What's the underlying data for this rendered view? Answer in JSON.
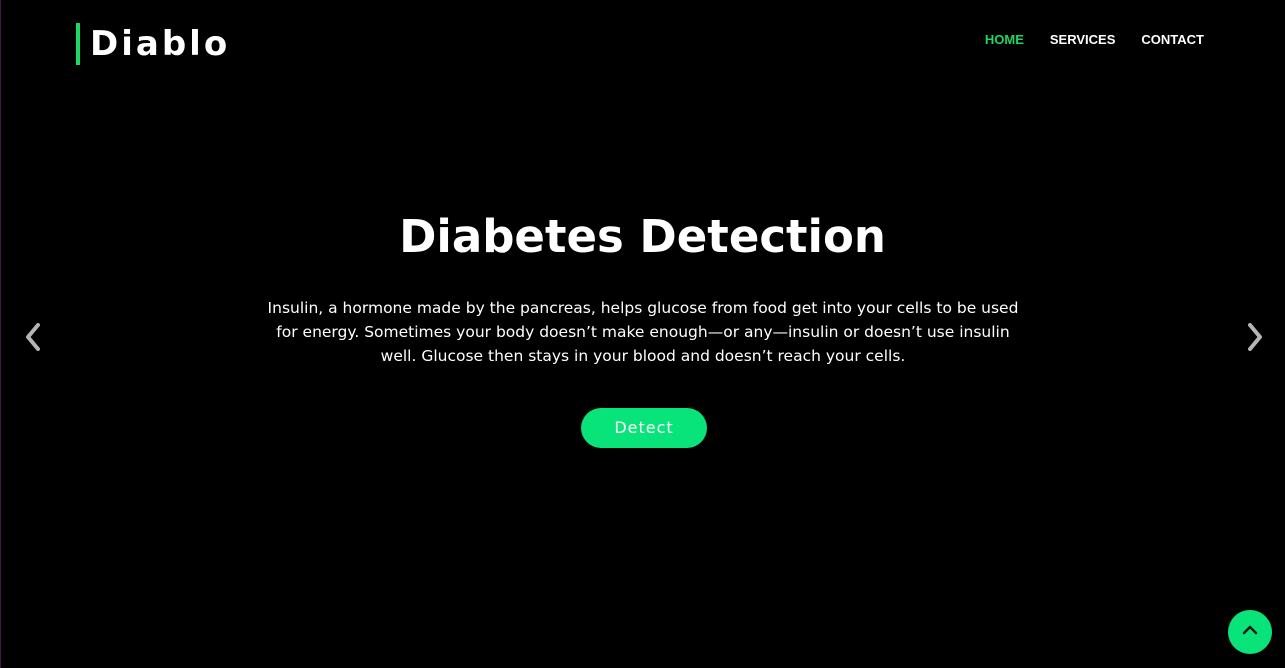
{
  "brand": {
    "name": "Diablo",
    "accent_color": "#1ed760"
  },
  "nav": {
    "items": [
      {
        "label": "HOME",
        "active": true
      },
      {
        "label": "SERVICES",
        "active": false
      },
      {
        "label": "CONTACT",
        "active": false
      }
    ]
  },
  "hero": {
    "title": "Diabetes Detection",
    "description": "Insulin, a hormone made by the pancreas, helps glucose from food get into your cells to be used for energy. Sometimes your body doesn’t make enough—or any—insulin or doesn’t use insulin well. Glucose then stays in your blood and doesn’t reach your cells.",
    "cta_label": "Detect",
    "cta_color": "#08e37a"
  },
  "carousel": {
    "prev_icon": "chevron-left-icon",
    "next_icon": "chevron-right-icon"
  },
  "back_to_top": {
    "icon": "chevron-up-icon",
    "color": "#08e37a"
  }
}
